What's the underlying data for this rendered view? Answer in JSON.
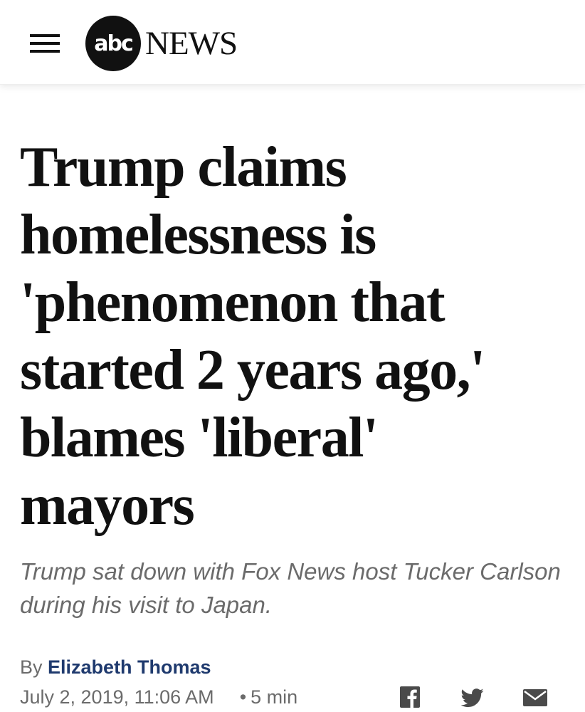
{
  "header": {
    "menu_icon": "hamburger-menu-icon",
    "logo_abc": "abc",
    "logo_news": "NEWS"
  },
  "article": {
    "headline": "Trump claims homelessness is 'phenomenon that started 2 years ago,' blames 'liberal' mayors",
    "subtitle": "Trump sat down with Fox News host Tucker Carlson during his visit to Japan.",
    "byline_prefix": "By",
    "author": "Elizabeth Thomas",
    "date": "July 2, 2019, 11:06 AM",
    "bullet": "•",
    "read_time": "5 min"
  },
  "share": {
    "icons": [
      "facebook-icon",
      "twitter-icon",
      "email-icon"
    ]
  },
  "colors": {
    "author_link": "#1f3a6e",
    "text_gray": "#6b6b6b",
    "headline": "#111111"
  }
}
